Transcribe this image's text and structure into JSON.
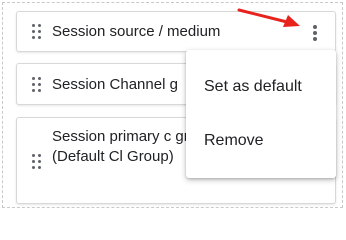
{
  "items": [
    {
      "label": "Session source / medium"
    },
    {
      "label": "Session Channel g"
    },
    {
      "label": "Session primary c group (Default Cl Group)"
    }
  ],
  "menu": {
    "items": [
      {
        "label": "Set as default"
      },
      {
        "label": "Remove"
      }
    ]
  },
  "colors": {
    "annotation_arrow": "#e8231e",
    "icon": "#5f6368",
    "text": "#202124",
    "border": "#d8d8d8"
  },
  "icons": {
    "drag": "drag-handle-icon",
    "more": "more-vert-icon"
  }
}
